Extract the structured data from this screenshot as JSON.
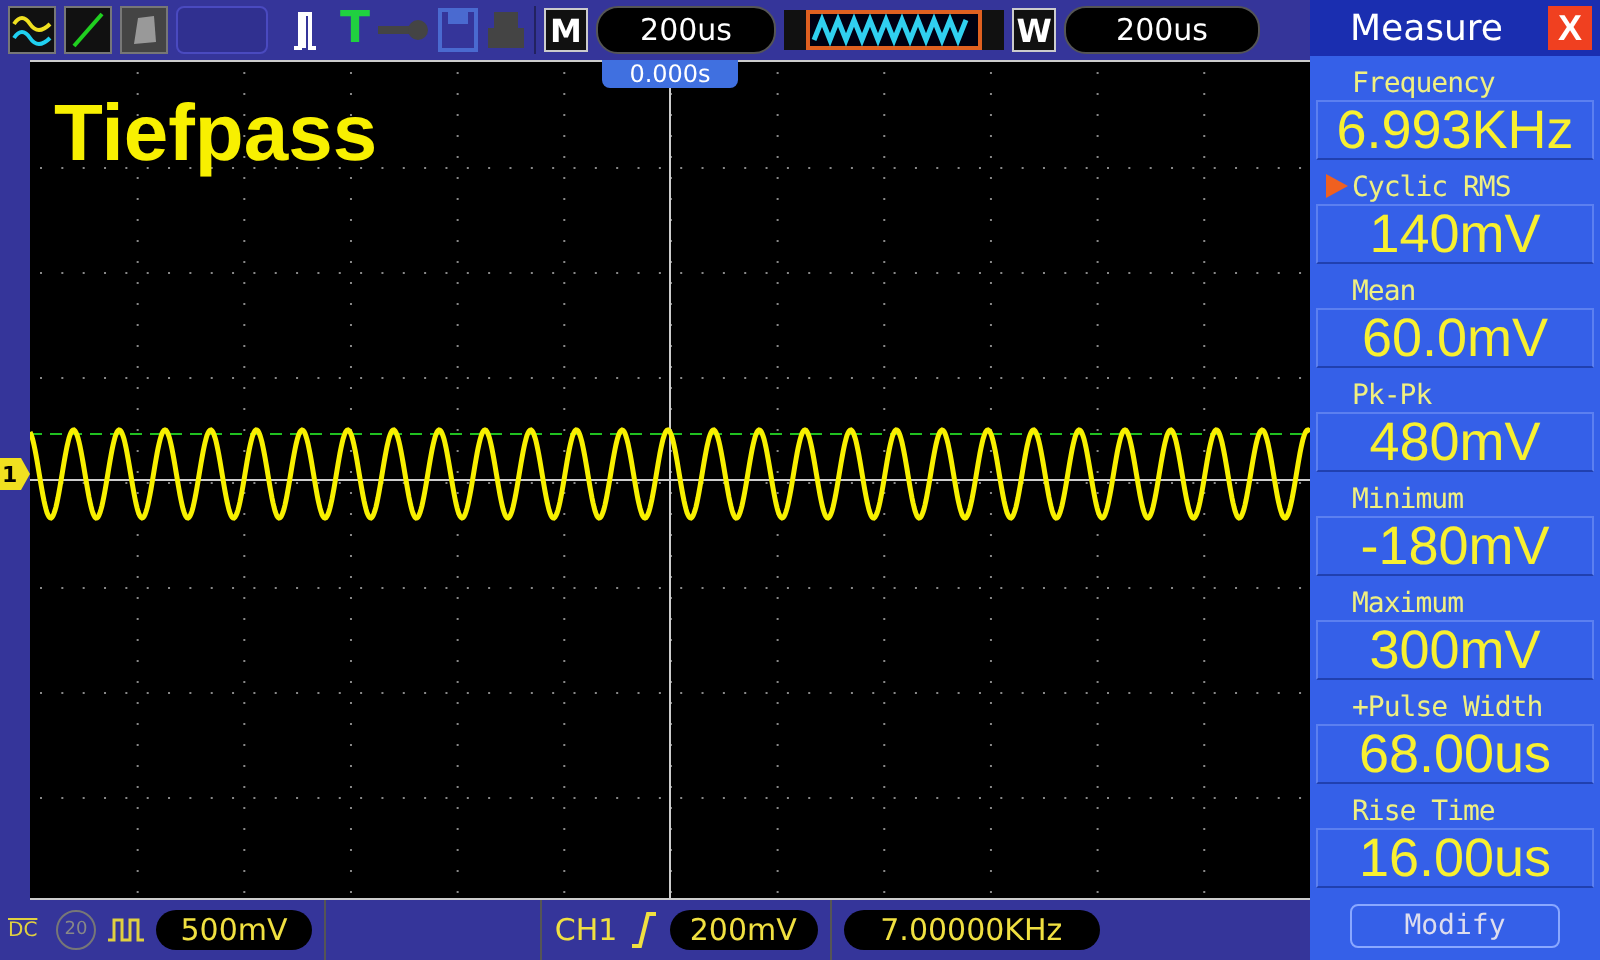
{
  "toolbar": {
    "trigger_key": "T",
    "mode_key": "M",
    "timebase": "200us",
    "window_key": "W",
    "window_timebase": "200us"
  },
  "trigger_position": "0.000s",
  "title": "Tiefpass",
  "channel_marker": "1",
  "measure": {
    "title": "Measure",
    "close": "X",
    "items": [
      {
        "label": "Frequency",
        "value": "6.993KHz",
        "selected": false
      },
      {
        "label": "Cyclic RMS",
        "value": "140mV",
        "selected": true
      },
      {
        "label": "Mean",
        "value": "60.0mV",
        "selected": false
      },
      {
        "label": "Pk-Pk",
        "value": "480mV",
        "selected": false
      },
      {
        "label": "Minimum",
        "value": "-180mV",
        "selected": false
      },
      {
        "label": "Maximum",
        "value": "300mV",
        "selected": false
      },
      {
        "label": "+Pulse Width",
        "value": "68.00us",
        "selected": false
      },
      {
        "label": "Rise Time",
        "value": "16.00us",
        "selected": false
      }
    ],
    "modify": "Modify"
  },
  "bottom": {
    "coupling": "DC",
    "bandwidth_limit": "20",
    "ch1_scale": "500mV",
    "trigger_source": "CH1",
    "trigger_level": "200mV",
    "trigger_frequency": "7.00000KHz"
  }
}
